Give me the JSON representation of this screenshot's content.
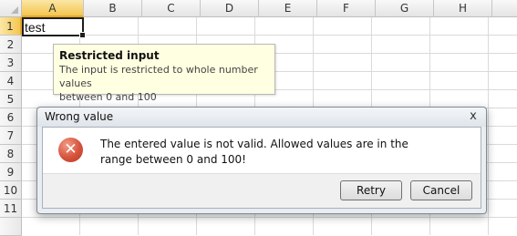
{
  "spreadsheet": {
    "columns": [
      "A",
      "B",
      "C",
      "D",
      "E",
      "F",
      "G",
      "H"
    ],
    "rows": [
      "1",
      "2",
      "3",
      "4",
      "5",
      "6",
      "7",
      "8",
      "9",
      "10",
      "11"
    ],
    "selected_column": "A",
    "selected_row": "1",
    "active_cell_value": "test"
  },
  "input_tooltip": {
    "title": "Restricted input",
    "line1": "The input is restricted to whole number values",
    "line2": "between 0 and 100"
  },
  "dialog": {
    "title": "Wrong value",
    "close_glyph": "x",
    "icon": "error-icon",
    "icon_glyph": "✕",
    "message": "The entered value is not valid. Allowed values are in the range between 0 and 100!",
    "retry_label": "Retry",
    "cancel_label": "Cancel"
  },
  "colors": {
    "header_selected": "#f4c64f",
    "tooltip_bg": "#ffffe1",
    "error_red": "#d5533b"
  }
}
